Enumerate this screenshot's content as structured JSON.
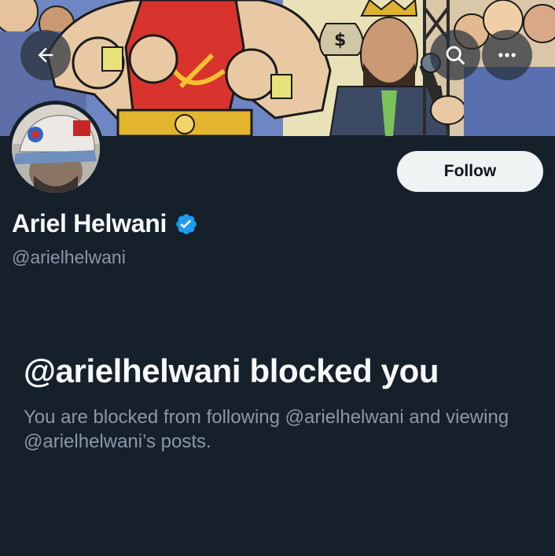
{
  "header": {
    "back_icon": "arrow-left-icon",
    "search_icon": "search-icon",
    "more_icon": "more-horizontal-icon"
  },
  "banner": {
    "description_icon": "comic-banner-illustration",
    "money_bag_symbol": "$"
  },
  "profile": {
    "display_name": "Ariel Helwani",
    "handle": "@arielhelwani",
    "verified": true,
    "verified_color": "#1d9bf0",
    "follow_label": "Follow"
  },
  "blocked": {
    "title": "@arielhelwani blocked you",
    "description": "You are blocked from following @arielhelwani and viewing @arielhelwani’s posts."
  },
  "colors": {
    "background": "#15202b",
    "text_primary": "#f7f9f9",
    "text_secondary": "#8b98a5",
    "button_bg": "#eff3f4"
  }
}
